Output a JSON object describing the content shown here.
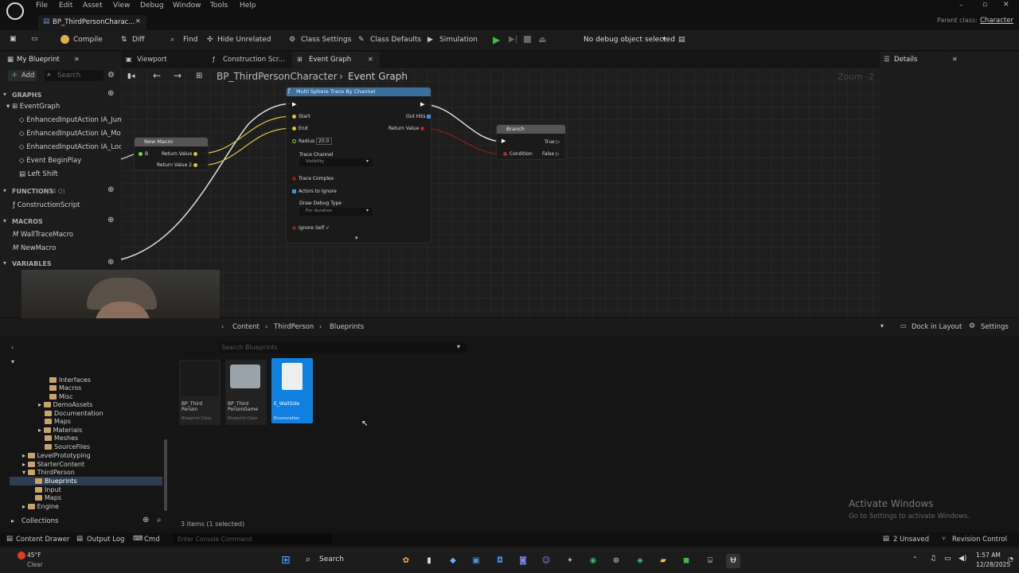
{
  "menubar": {
    "items": [
      "File",
      "Edit",
      "Asset",
      "View",
      "Debug",
      "Window",
      "Tools",
      "Help"
    ],
    "parent_class_label": "Parent class:",
    "parent_class_value": "Character"
  },
  "doc_tab": {
    "title": "BP_ThirdPersonCharac..."
  },
  "toolbar": {
    "compile": "Compile",
    "diff": "Diff",
    "find": "Find",
    "hide_unrelated": "Hide Unrelated",
    "class_settings": "Class Settings",
    "class_defaults": "Class Defaults",
    "simulation": "Simulation",
    "debug_object": "No debug object selected"
  },
  "my_blueprint": {
    "title": "My Blueprint",
    "add": "Add",
    "search_placeholder": "Search",
    "graphs_header": "GRAPHS",
    "graphs": [
      "EventGraph",
      "EnhancedInputAction IA_Jump",
      "EnhancedInputAction IA_Move",
      "EnhancedInputAction IA_Look",
      "Event BeginPlay",
      "Left Shift"
    ],
    "functions_header": "FUNCTIONS",
    "functions_count": "(34 O)",
    "functions": [
      "ConstructionScript"
    ],
    "macros_header": "MACROS",
    "macros": [
      "WallTraceMacro",
      "NewMacro"
    ],
    "variables_header": "VARIABLES"
  },
  "editor_tabs": {
    "viewport": "Viewport",
    "construction": "Construction Scr...",
    "event_graph": "Event Graph",
    "details": "Details"
  },
  "graph": {
    "breadcrumb_root": "BP_ThirdPersonCharacter",
    "breadcrumb_leaf": "Event Graph",
    "zoom": "Zoom -2",
    "trace_node": {
      "title": "Multi Sphere Trace By Channel",
      "start": "Start",
      "end": "End",
      "radius": "Radius",
      "radius_value": "20.0",
      "trace_channel": "Trace Channel",
      "trace_channel_value": "Visibility",
      "trace_complex": "Trace Complex",
      "actors_to_ignore": "Actors to Ignore",
      "draw_debug_type": "Draw Debug Type",
      "draw_debug_value": "For duration",
      "ignore_self": "Ignore Self",
      "out_hits": "Out Hits",
      "return_value": "Return Value"
    },
    "macro_node": {
      "title": "New Macro",
      "b": "B",
      "return_value": "Return Value",
      "return_value_2": "Return Value 2"
    },
    "branch_node": {
      "title": "Branch",
      "condition": "Condition",
      "true": "True",
      "false": "False"
    }
  },
  "content_browser": {
    "path": [
      "Content",
      "ThirdPerson",
      "Blueprints"
    ],
    "dock": "Dock in Layout",
    "settings": "Settings",
    "search_placeholder": "Search Blueprints",
    "tree": [
      "Interfaces",
      "Macros",
      "Misc",
      "DemoAssets",
      "Documentation",
      "Maps",
      "Materials",
      "Meshes",
      "SourceFiles",
      "LevelPrototyping",
      "StarterContent",
      "ThirdPerson",
      "Blueprints",
      "Input",
      "Maps",
      "Engine"
    ],
    "assets": [
      {
        "name": "BP_Third Person",
        "type": "Blueprint Class"
      },
      {
        "name": "BP_Third PersonGame",
        "type": "Blueprint Class"
      },
      {
        "name": "E_WallSide",
        "type": "Enumeration"
      }
    ],
    "collections": "Collections",
    "count": "3 items (1 selected)"
  },
  "statusbar": {
    "content_drawer": "Content Drawer",
    "output_log": "Output Log",
    "cmd": "Cmd",
    "console_placeholder": "Enter Console Command",
    "unsaved": "2 Unsaved",
    "revision": "Revision Control"
  },
  "watermark": {
    "title": "Activate Windows",
    "subtitle": "Go to Settings to activate Windows."
  },
  "taskbar": {
    "weather_temp": "45°F",
    "weather_desc": "Clear",
    "search": "Search",
    "time": "1:57 AM",
    "date": "12/28/2025"
  }
}
